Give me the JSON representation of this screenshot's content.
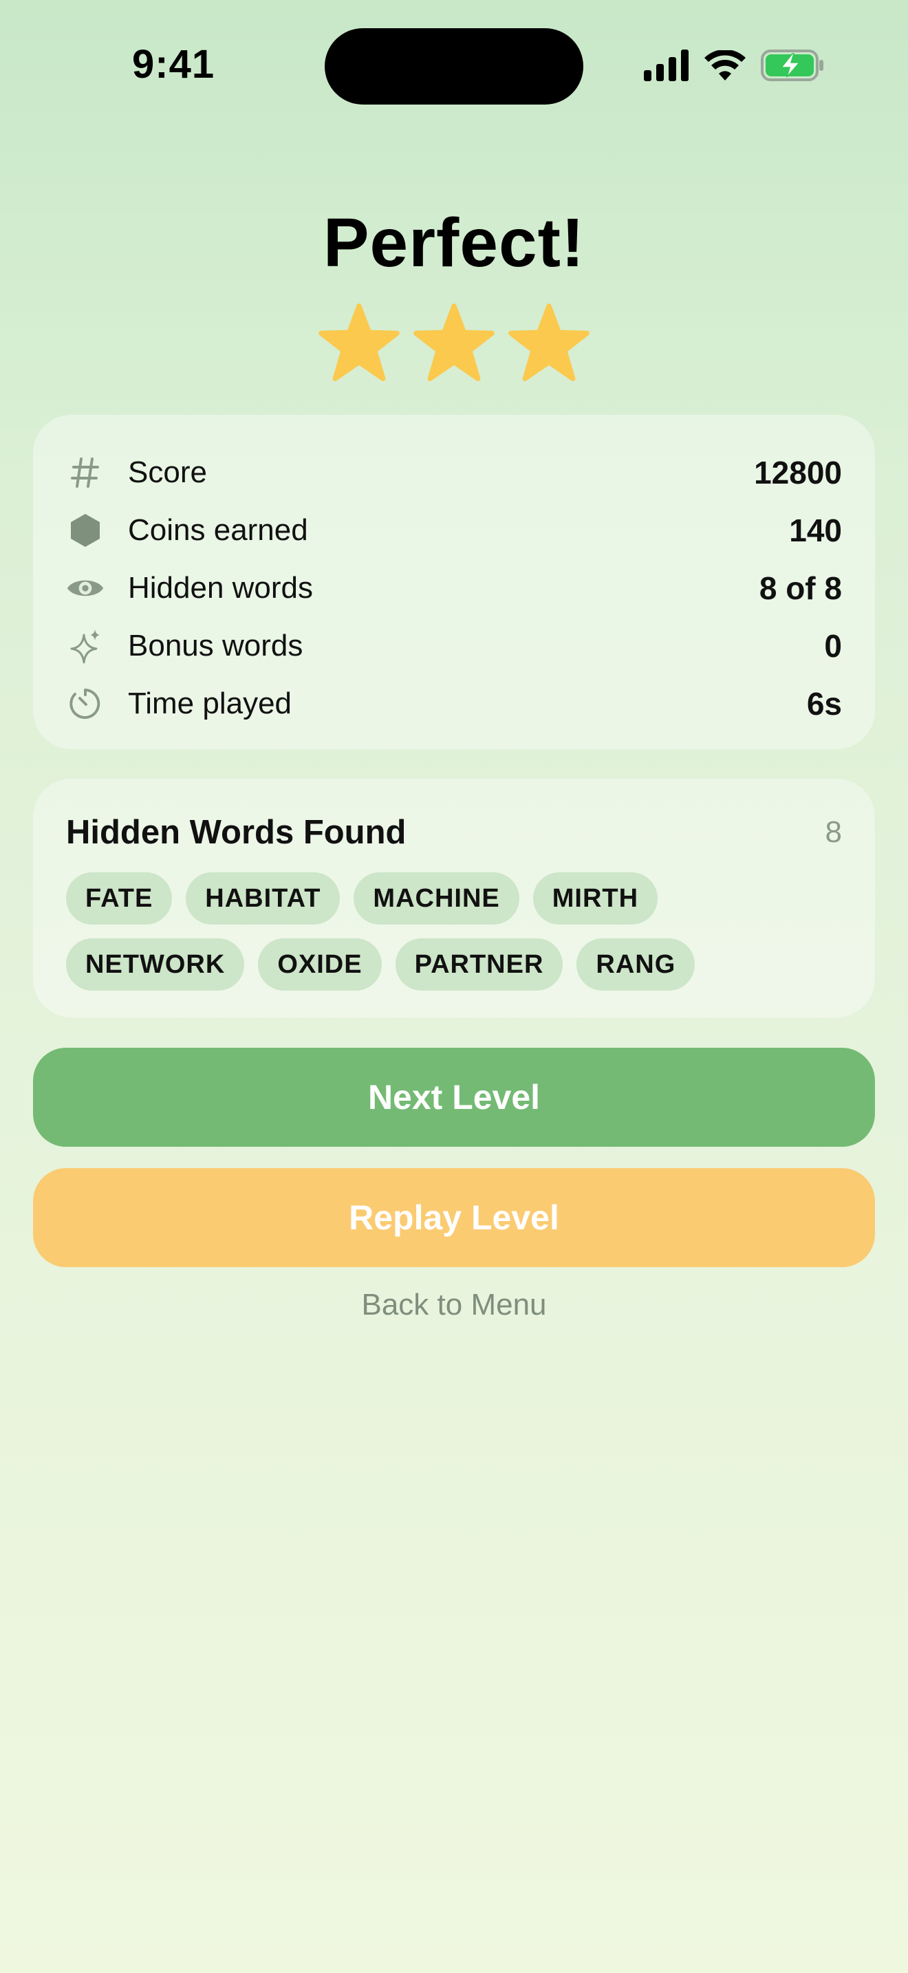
{
  "status_bar": {
    "time": "9:41",
    "icons": [
      "signal-icon",
      "wifi-icon",
      "battery-charging-icon"
    ]
  },
  "header": {
    "title": "Perfect!",
    "stars_earned": 3,
    "stars_total": 3,
    "star_color": "#fbc94d"
  },
  "stats": [
    {
      "icon": "hash-icon",
      "label": "Score",
      "value": "12800"
    },
    {
      "icon": "coin-icon",
      "label": "Coins earned",
      "value": "140"
    },
    {
      "icon": "eye-icon",
      "label": "Hidden words",
      "value": "8 of 8"
    },
    {
      "icon": "sparkle-icon",
      "label": "Bonus words",
      "value": "0"
    },
    {
      "icon": "timer-icon",
      "label": "Time played",
      "value": "6s"
    }
  ],
  "hidden_words": {
    "title": "Hidden Words Found",
    "count": "8",
    "words": [
      "FATE",
      "HABITAT",
      "MACHINE",
      "MIRTH",
      "NETWORK",
      "OXIDE",
      "PARTNER",
      "RANG"
    ]
  },
  "actions": {
    "next_label": "Next Level",
    "replay_label": "Replay Level",
    "back_label": "Back to Menu",
    "next_color": "#74ba74",
    "replay_color": "#fbcb72"
  }
}
